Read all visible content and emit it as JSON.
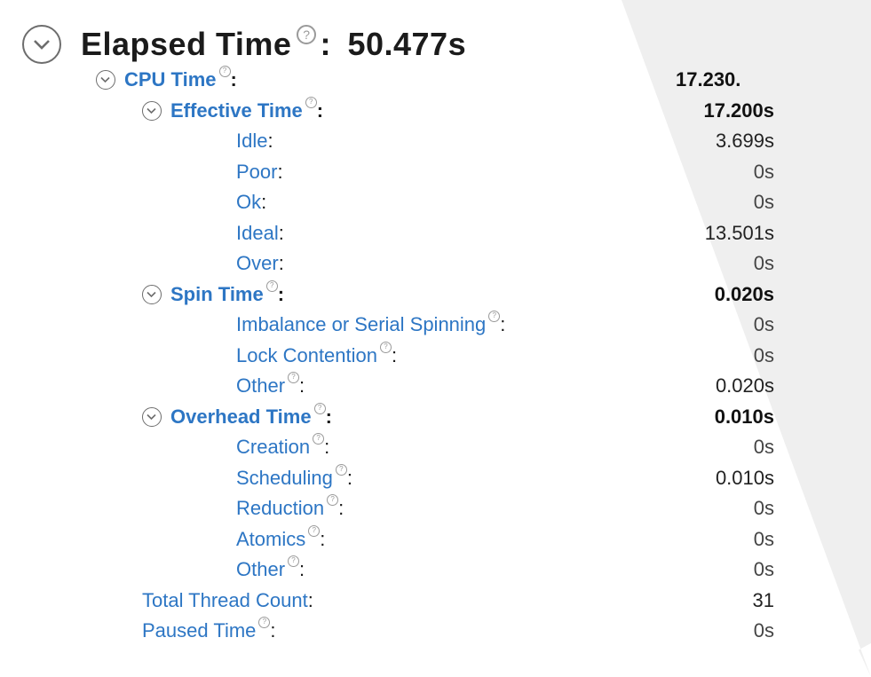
{
  "header": {
    "title": "Elapsed Time",
    "value": "50.477s"
  },
  "colon": ":",
  "help_glyph": "?",
  "rows": {
    "cpu": {
      "label": "CPU Time",
      "value": "17.230."
    },
    "effective": {
      "label": "Effective Time",
      "value": "17.200s"
    },
    "idle": {
      "label": "Idle",
      "value": "3.699s"
    },
    "poor": {
      "label": "Poor",
      "value": "0s"
    },
    "ok": {
      "label": "Ok",
      "value": "0s"
    },
    "ideal": {
      "label": "Ideal",
      "value": "13.501s"
    },
    "over": {
      "label": "Over",
      "value": "0s"
    },
    "spin": {
      "label": "Spin Time",
      "value": "0.020s"
    },
    "imbalance": {
      "label": "Imbalance or Serial Spinning",
      "value": "0s"
    },
    "lock": {
      "label": "Lock Contention",
      "value": "0s"
    },
    "spin_other": {
      "label": "Other",
      "value": "0.020s"
    },
    "overhead": {
      "label": "Overhead Time",
      "value": "0.010s"
    },
    "creation": {
      "label": "Creation",
      "value": "0s"
    },
    "scheduling": {
      "label": "Scheduling",
      "value": "0.010s"
    },
    "reduction": {
      "label": "Reduction",
      "value": "0s"
    },
    "atomics": {
      "label": "Atomics",
      "value": "0s"
    },
    "overhead_other": {
      "label": "Other",
      "value": "0s"
    },
    "threads": {
      "label": "Total Thread Count",
      "value": "31"
    },
    "paused": {
      "label": "Paused Time",
      "value": "0s"
    }
  },
  "colors": {
    "link": "#2d76c4",
    "text": "#1a1a1a",
    "toggle_border": "#6d6d6d"
  }
}
